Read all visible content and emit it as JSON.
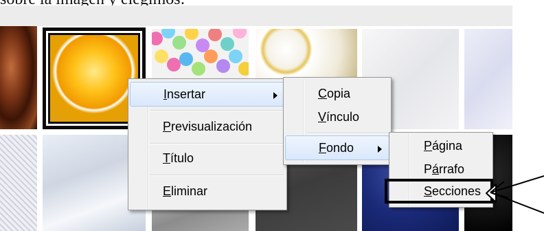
{
  "instruction_text": "sobre la imagen y elegimos:",
  "menu1": {
    "items": [
      {
        "label": "Insertar",
        "accel": "I",
        "has_submenu": true,
        "highlighted": true
      },
      {
        "label": "Previsualización",
        "accel": "P"
      },
      {
        "label": "Título",
        "accel": "T"
      },
      {
        "label": "Eliminar",
        "accel": "E"
      }
    ]
  },
  "menu2": {
    "items": [
      {
        "label": "Copia",
        "accel": "C"
      },
      {
        "label": "Vínculo",
        "accel": "V"
      },
      {
        "label": "Fondo",
        "accel": "F",
        "has_submenu": true,
        "highlighted": true
      }
    ]
  },
  "menu3": {
    "items": [
      {
        "label": "Página",
        "accel": "P"
      },
      {
        "label": "Párrafo",
        "accel": "á"
      },
      {
        "label": "Secciones",
        "accel": "S",
        "selected": true
      }
    ]
  },
  "colors": {
    "menu_bg": "#f0f0f0",
    "highlight_from": "#eef5fd",
    "highlight_to": "#d9e8fb",
    "highlight_border": "#a9c9ef"
  },
  "icons": [
    "submenu-arrow-icon",
    "pointer-arrow-icon"
  ]
}
